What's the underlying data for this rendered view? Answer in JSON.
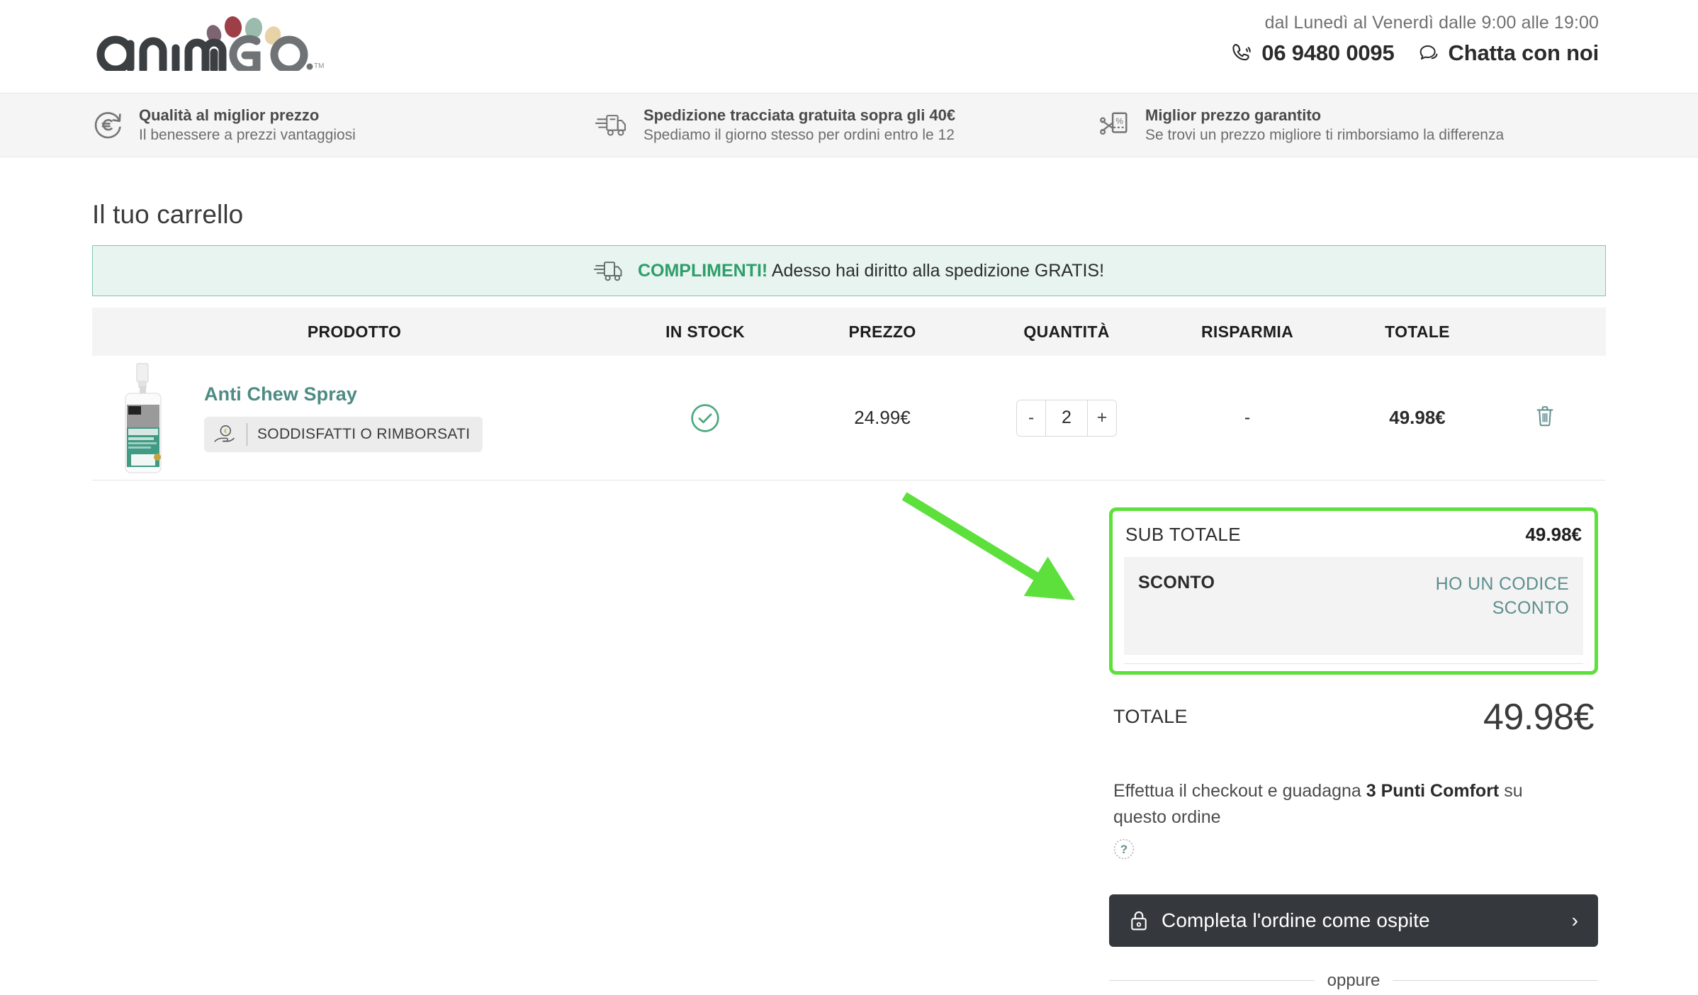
{
  "brand": {
    "name": "animiGo",
    "trademark": "TM"
  },
  "header": {
    "hours": "dal Lunedì al Venerdì dalle 9:00 alle 19:00",
    "phone": "06 9480 0095",
    "chat": "Chatta con noi",
    "phone_icon": "phone-icon",
    "chat_icon": "chat-bubble-icon"
  },
  "usp": [
    {
      "icon": "euro-refund-icon",
      "title": "Qualità al miglior prezzo",
      "subtitle": "Il benessere a prezzi vantaggiosi"
    },
    {
      "icon": "delivery-truck-icon",
      "title": "Spedizione tracciata gratuita sopra gli 40€",
      "subtitle": "Spediamo il giorno stesso per ordini entro le 12"
    },
    {
      "icon": "coupon-scissors-icon",
      "title": "Miglior prezzo garantito",
      "subtitle": "Se trovi un prezzo migliore ti rimborsiamo la differenza"
    }
  ],
  "cart": {
    "title": "Il tuo carrello",
    "shipping_banner": {
      "icon": "delivery-truck-icon",
      "highlight": "COMPLIMENTI!",
      "text": " Adesso hai diritto alla spedizione GRATIS!"
    },
    "columns": {
      "product": "PRODOTTO",
      "stock": "IN STOCK",
      "price": "PREZZO",
      "quantity": "QUANTITÀ",
      "save": "RISPARMIA",
      "total": "TOTALE"
    },
    "items": [
      {
        "name": "Anti Chew Spray",
        "badge": "SODDISFATTI O RIMBORSATI",
        "badge_icon": "hand-holding-coin-icon",
        "stock_icon": "check-circle-icon",
        "price": "24.99€",
        "qty_minus": "-",
        "qty_value": "2",
        "qty_plus": "+",
        "save": "-",
        "total": "49.98€",
        "delete_icon": "trash-icon",
        "image_alt": "anti-chew-spray-bottle"
      }
    ]
  },
  "summary": {
    "subtotal_label": "SUB TOTALE",
    "subtotal_value": "49.98€",
    "discount_label": "SCONTO",
    "discount_link": "HO UN CODICE SCONTO",
    "total_label": "TOTALE",
    "total_value": "49.98€",
    "loyalty_pre": "Effettua il checkout e guadagna ",
    "loyalty_bold": "3 Punti Comfort",
    "loyalty_post": " su questo ordine",
    "help_icon": "question-mark-icon",
    "checkout_label": "Completa l'ordine come ospite",
    "checkout_icon": "lock-icon",
    "checkout_chevron": "›",
    "or_label": "oppure"
  },
  "annotation": {
    "arrow_color": "#5de03c",
    "highlight_color": "#5de03c"
  },
  "colors": {
    "teal": "#4e8b85",
    "green": "#2e9e6b",
    "dark": "#35393d",
    "banner_bg": "#e8f4ef"
  }
}
